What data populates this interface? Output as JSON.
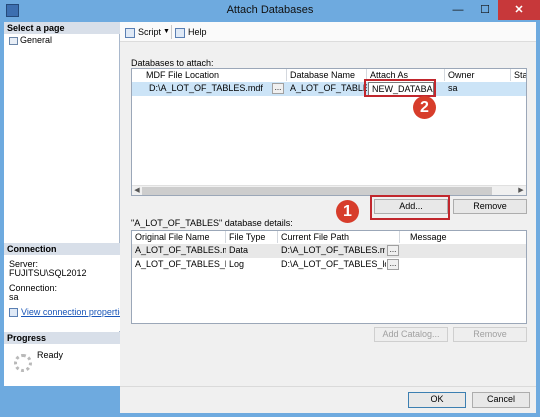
{
  "window": {
    "title": "Attach Databases",
    "min_glyph": "—",
    "max_glyph": "☐",
    "close_glyph": "✕"
  },
  "side": {
    "select_page_header": "Select a page",
    "pages": [
      {
        "label": "General",
        "icon": "page-icon"
      }
    ],
    "connection_header": "Connection",
    "server_label": "Server:",
    "server_value": "FUJITSU\\SQL2012",
    "connection_label": "Connection:",
    "connection_value": "sa",
    "view_connection_link": "View connection properties",
    "progress_header": "Progress",
    "progress_status": "Ready"
  },
  "toolbar": {
    "script_label": "Script",
    "script_dropdown_glyph": "▼",
    "help_label": "Help"
  },
  "attach": {
    "section_label": "Databases to attach:",
    "columns": [
      "MDF File Location",
      "Database Name",
      "Attach As",
      "Owner",
      "Status"
    ],
    "rows": [
      {
        "mdf": "D:\\A_LOT_OF_TABLES.mdf",
        "browse": "...",
        "db_name": "A_LOT_OF_TABLES",
        "attach_as": "NEW_DATABASE",
        "owner": "sa",
        "status": ""
      }
    ],
    "add_button": "Add...",
    "remove_button": "Remove"
  },
  "details": {
    "section_label": "\"A_LOT_OF_TABLES\" database details:",
    "columns": [
      "Original File Name",
      "File Type",
      "Current File Path",
      "Message"
    ],
    "rows": [
      {
        "original": "A_LOT_OF_TABLES.mdf",
        "type": "Data",
        "path": "D:\\A_LOT_OF_TABLES.mdf",
        "browse": "...",
        "message": ""
      },
      {
        "original": "A_LOT_OF_TABLES_lo...",
        "type": "Log",
        "path": "D:\\A_LOT_OF_TABLES_log.ldf",
        "browse": "...",
        "message": ""
      }
    ],
    "add_catalog_button": "Add Catalog...",
    "remove_button": "Remove"
  },
  "footer": {
    "ok_button": "OK",
    "cancel_button": "Cancel"
  },
  "callouts": {
    "one": "1",
    "two": "2"
  },
  "colors": {
    "titlebar": "#6eaadf",
    "selected_row": "#cce4f7",
    "callout": "#d73d2b",
    "close_button": "#c7383a",
    "link": "#1a56b8"
  }
}
